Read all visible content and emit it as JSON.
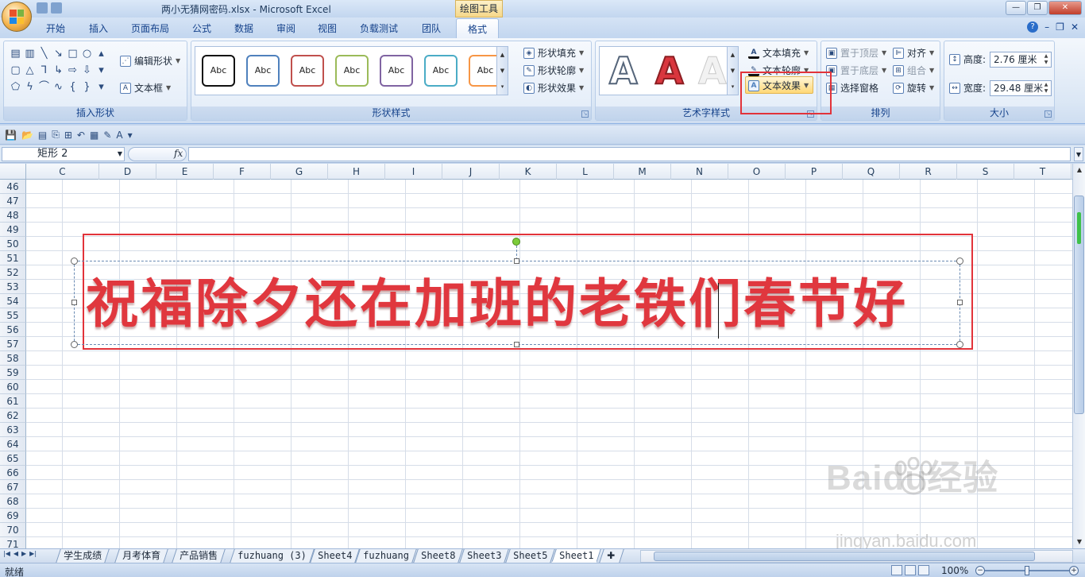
{
  "title": {
    "window_title": "两小无猜网密码.xlsx - Microsoft Excel",
    "contextual_tool": "绘图工具"
  },
  "tabs": [
    "开始",
    "插入",
    "页面布局",
    "公式",
    "数据",
    "审阅",
    "视图",
    "负载测试",
    "团队",
    "格式"
  ],
  "active_tab": "格式",
  "ribbon": {
    "insert_shapes": {
      "label": "插入形状",
      "edit_shape": "编辑形状",
      "text_box": "文本框"
    },
    "shape_styles": {
      "label": "形状样式",
      "thumb_text": "Abc",
      "thumb_colors": [
        "#111111",
        "#4f81bd",
        "#c0504d",
        "#9bbb59",
        "#8064a2",
        "#4bacc6",
        "#f79646"
      ],
      "fill": "形状填充",
      "outline": "形状轮廓",
      "effects": "形状效果"
    },
    "wordart_styles": {
      "label": "艺术字样式",
      "thumb_text": "A",
      "text_fill": "文本填充",
      "text_outline": "文本轮廓",
      "text_effects": "文本效果"
    },
    "arrange": {
      "label": "排列",
      "bring_front": "置于顶层",
      "send_back": "置于底层",
      "selection_pane": "选择窗格",
      "align": "对齐",
      "group": "组合",
      "rotate": "旋转"
    },
    "size": {
      "label": "大小",
      "height_label": "高度:",
      "height_value": "2.76 厘米",
      "width_label": "宽度:",
      "width_value": "29.48 厘米"
    }
  },
  "formula_bar": {
    "name_box": "矩形 2",
    "fx": "fx"
  },
  "columns": [
    "C",
    "D",
    "E",
    "F",
    "G",
    "H",
    "I",
    "J",
    "K",
    "L",
    "M",
    "N",
    "O",
    "P",
    "Q",
    "R",
    "S",
    "T"
  ],
  "rows": [
    "46",
    "47",
    "48",
    "49",
    "50",
    "51",
    "52",
    "53",
    "54",
    "55",
    "56",
    "57",
    "58",
    "59",
    "60",
    "61",
    "62",
    "63",
    "64",
    "65",
    "66",
    "67",
    "68",
    "69",
    "70",
    "71"
  ],
  "shape_text": "祝福除夕还在加班的老铁们春节好",
  "sheet_tabs": [
    "学生成绩",
    "月考体育",
    "产品销售",
    "fuzhuang (3)",
    "Sheet4",
    "fuzhuang",
    "Sheet8",
    "Sheet3",
    "Sheet5",
    "Sheet1"
  ],
  "active_sheet": "Sheet1",
  "status": {
    "ready": "就绪",
    "zoom": "100%"
  },
  "watermark": {
    "brand": "Baidu经验",
    "url": "jingyan.baidu.com"
  },
  "colors": {
    "accent_red": "#e2333a",
    "wordart_red": "#e0373e",
    "highlight_yellow": "#ffd877"
  }
}
